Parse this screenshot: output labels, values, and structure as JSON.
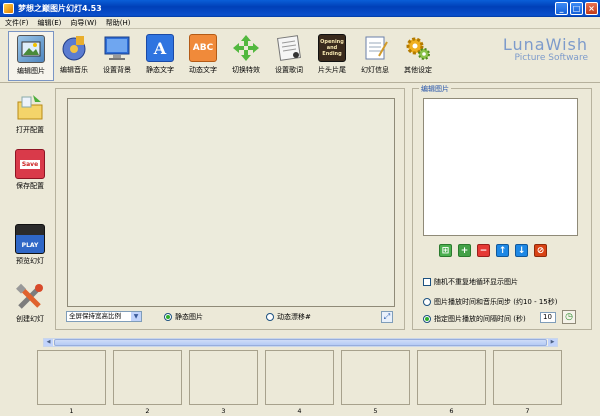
{
  "window": {
    "title": "梦想之巅图片幻灯4.53"
  },
  "menu": {
    "items": [
      "文件(F)",
      "编辑(E)",
      "向导(W)",
      "帮助(H)"
    ]
  },
  "toolbar": {
    "items": [
      {
        "label": "编辑图片",
        "icon": "photo-edit-icon",
        "active": true
      },
      {
        "label": "编辑音乐",
        "icon": "music-disc-icon",
        "active": false
      },
      {
        "label": "设置背景",
        "icon": "monitor-icon",
        "active": false
      },
      {
        "label": "静态文字",
        "icon": "text-a-icon",
        "active": false
      },
      {
        "label": "动态文字",
        "icon": "text-abc-icon",
        "active": false
      },
      {
        "label": "切换特效",
        "icon": "arrows-icon",
        "active": false
      },
      {
        "label": "设置歌词",
        "icon": "lyrics-icon",
        "active": false
      },
      {
        "label": "片头片尾",
        "icon": "film-icon",
        "active": false
      },
      {
        "label": "幻灯信息",
        "icon": "notepad-icon",
        "active": false
      },
      {
        "label": "其他设定",
        "icon": "gears-icon",
        "active": false
      }
    ],
    "film_text_1": "Opening",
    "film_text_2": "and Ending",
    "abc_text": "ABC",
    "a_text": "A"
  },
  "brand": {
    "line1": "LunaWish",
    "line2": "Picture Software"
  },
  "sidebar": {
    "items": [
      {
        "label": "打开配置",
        "icon": "open-folder-icon"
      },
      {
        "label": "保存配置",
        "icon": "save-disk-icon",
        "badge": "Save"
      },
      {
        "label": "预览幻灯",
        "icon": "clapper-play-icon",
        "badge": "PLAY"
      },
      {
        "label": "创建幻灯",
        "icon": "tools-icon"
      }
    ]
  },
  "preview_panel": {
    "ratio_select_value": "全屏保持宽高比例",
    "radio_static": "静态图片",
    "radio_dynamic": "动态漂移#",
    "static_checked": true
  },
  "edit_panel": {
    "legend": "编辑图片",
    "buttons": [
      "select-all-icon",
      "add-icon",
      "remove-icon",
      "move-up-icon",
      "move-down-icon",
      "delete-icon"
    ],
    "random_checkbox_label": "随机不重复地循环显示图片",
    "sync_radio_label": "图片播放时间和音乐同步 (约10 - 15秒)",
    "interval_radio_label": "指定图片播放的间隔时间 (秒)",
    "interval_value": "10",
    "interval_checked": true
  },
  "timeline": {
    "slides": [
      "1",
      "2",
      "3",
      "4",
      "5",
      "6",
      "7"
    ]
  },
  "colors": {
    "titlebar": "#0a4fcc",
    "background": "#ece9d8",
    "brand": "#7d9bcb"
  }
}
